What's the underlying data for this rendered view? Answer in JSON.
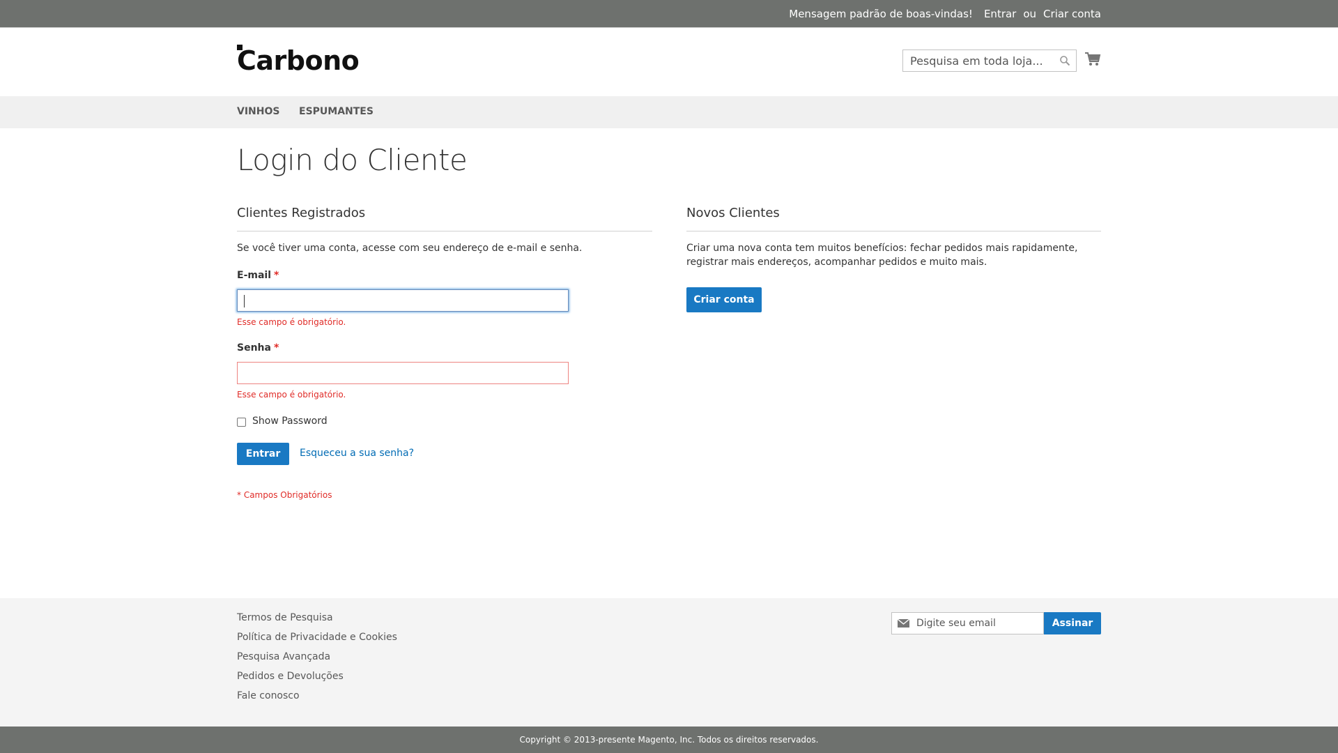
{
  "topbar": {
    "welcome": "Mensagem padrão de boas-vindas!",
    "signin": "Entrar",
    "or": "ou",
    "create_account": "Criar conta"
  },
  "header": {
    "logo_text": "Carbono",
    "search_placeholder": "Pesquisa em toda loja..."
  },
  "nav": {
    "items": [
      "VINHOS",
      "ESPUMANTES"
    ]
  },
  "page": {
    "title": "Login do Cliente"
  },
  "registered": {
    "title": "Clientes Registrados",
    "intro": "Se você tiver uma conta, acesse com seu endereço de e-mail e senha.",
    "email_label": "E-mail",
    "password_label": "Senha",
    "required_mark": "*",
    "error_text": "Esse campo é obrigatório.",
    "show_password_label": "Show Password",
    "signin_button": "Entrar",
    "forgot_link": "Esqueceu a sua senha?",
    "required_note": "* Campos Obrigatórios"
  },
  "new_customers": {
    "title": "Novos Clientes",
    "text_line1": "Criar uma nova conta tem muitos benefícios: fechar pedidos mais rapidamente,",
    "text_line2": "registrar mais endereços, acompanhar pedidos e muito mais.",
    "create_button": "Criar conta"
  },
  "footer": {
    "links": [
      "Termos de Pesquisa",
      "Política de Privacidade e Cookies",
      "Pesquisa Avançada",
      "Pedidos e Devoluções",
      "Fale conosco"
    ],
    "newsletter_placeholder": "Digite seu email",
    "subscribe_button": "Assinar",
    "copyright": "Copyright © 2013-presente Magento, Inc. Todos os direitos reservados."
  },
  "colors": {
    "primary": "#1979c3",
    "error": "#e02b27",
    "topbar": "#6e716e"
  }
}
